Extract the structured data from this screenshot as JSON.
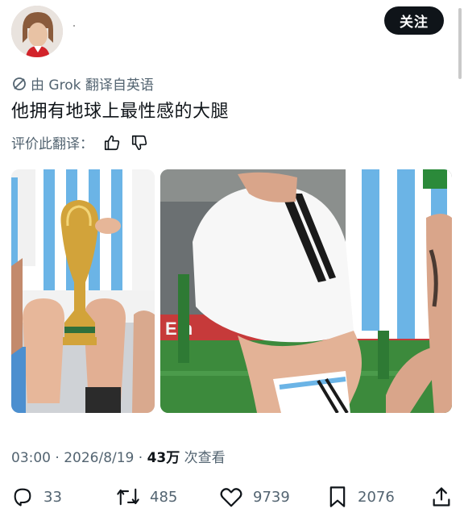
{
  "header": {
    "follow_label": "关注",
    "avatar_icon": "avatar"
  },
  "translation": {
    "label": "由 Grok 翻译自英语",
    "icon": "grok-icon"
  },
  "tweet": {
    "text": "他拥有地球上最性感的大腿"
  },
  "rating": {
    "label": "评价此翻译：",
    "up_icon": "thumbs-up-icon",
    "down_icon": "thumbs-down-icon"
  },
  "meta": {
    "time": "03:00 · 2026/8/19 · ",
    "views_count": "43万",
    "views_label": " 次查看"
  },
  "actions": {
    "replies": "33",
    "reposts": "485",
    "likes": "9739",
    "bookmarks": "2076"
  },
  "colors": {
    "text": "#0f1419",
    "secondary": "#536471",
    "follow_bg": "#0f1419"
  }
}
